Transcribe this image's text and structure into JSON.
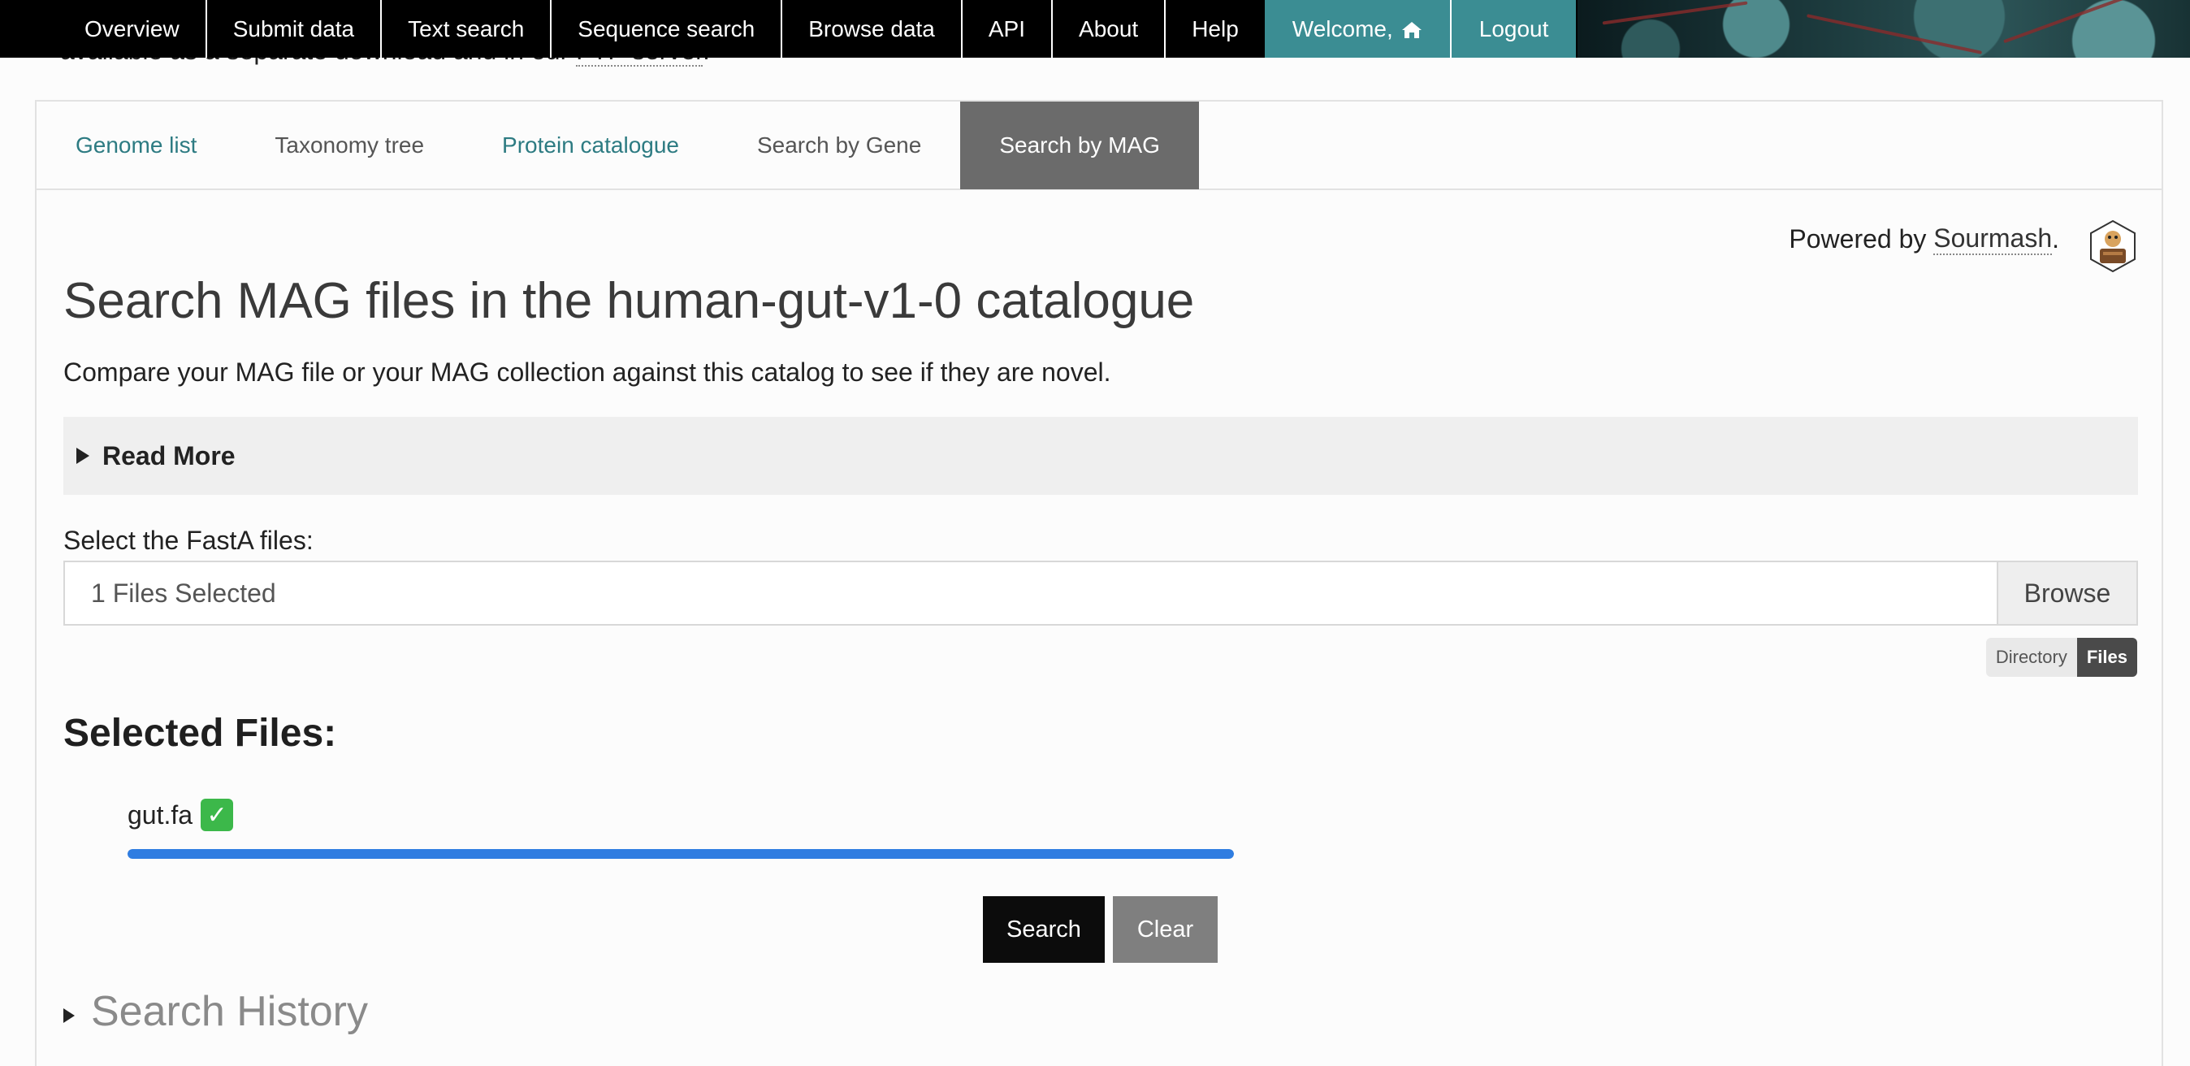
{
  "behind": {
    "text_before": "available as a separate download and in our ",
    "link": "FTP server",
    "text_after": "."
  },
  "nav": {
    "items": [
      "Overview",
      "Submit data",
      "Text search",
      "Sequence search",
      "Browse data",
      "API",
      "About",
      "Help"
    ],
    "welcome": "Welcome,",
    "logout": "Logout"
  },
  "tabs": [
    "Genome list",
    "Taxonomy tree",
    "Protein catalogue",
    "Search by Gene",
    "Search by MAG"
  ],
  "powered": {
    "prefix": "Powered by ",
    "source": "Sourmash",
    "suffix": "."
  },
  "page": {
    "title": "Search MAG files in the human-gut-v1-0 catalogue",
    "subtitle": "Compare your MAG file or your MAG collection against this catalog to see if they are novel.",
    "read_more": "Read More"
  },
  "upload": {
    "label": "Select the FastA files:",
    "value": "1 Files Selected",
    "browse": "Browse",
    "mode_options": [
      "Directory",
      "Files"
    ],
    "mode_selected": "Files"
  },
  "selected": {
    "heading": "Selected Files:",
    "files": [
      {
        "name": "gut.fa",
        "status_icon": "check-mark-icon",
        "progress": 1.0
      }
    ]
  },
  "actions": {
    "search": "Search",
    "clear": "Clear"
  },
  "history": {
    "label": "Search History"
  },
  "colors": {
    "teal": "#3b8d93",
    "link": "#2d7b82",
    "progress": "#2f7de1",
    "active_tab": "#6b6b6b"
  }
}
